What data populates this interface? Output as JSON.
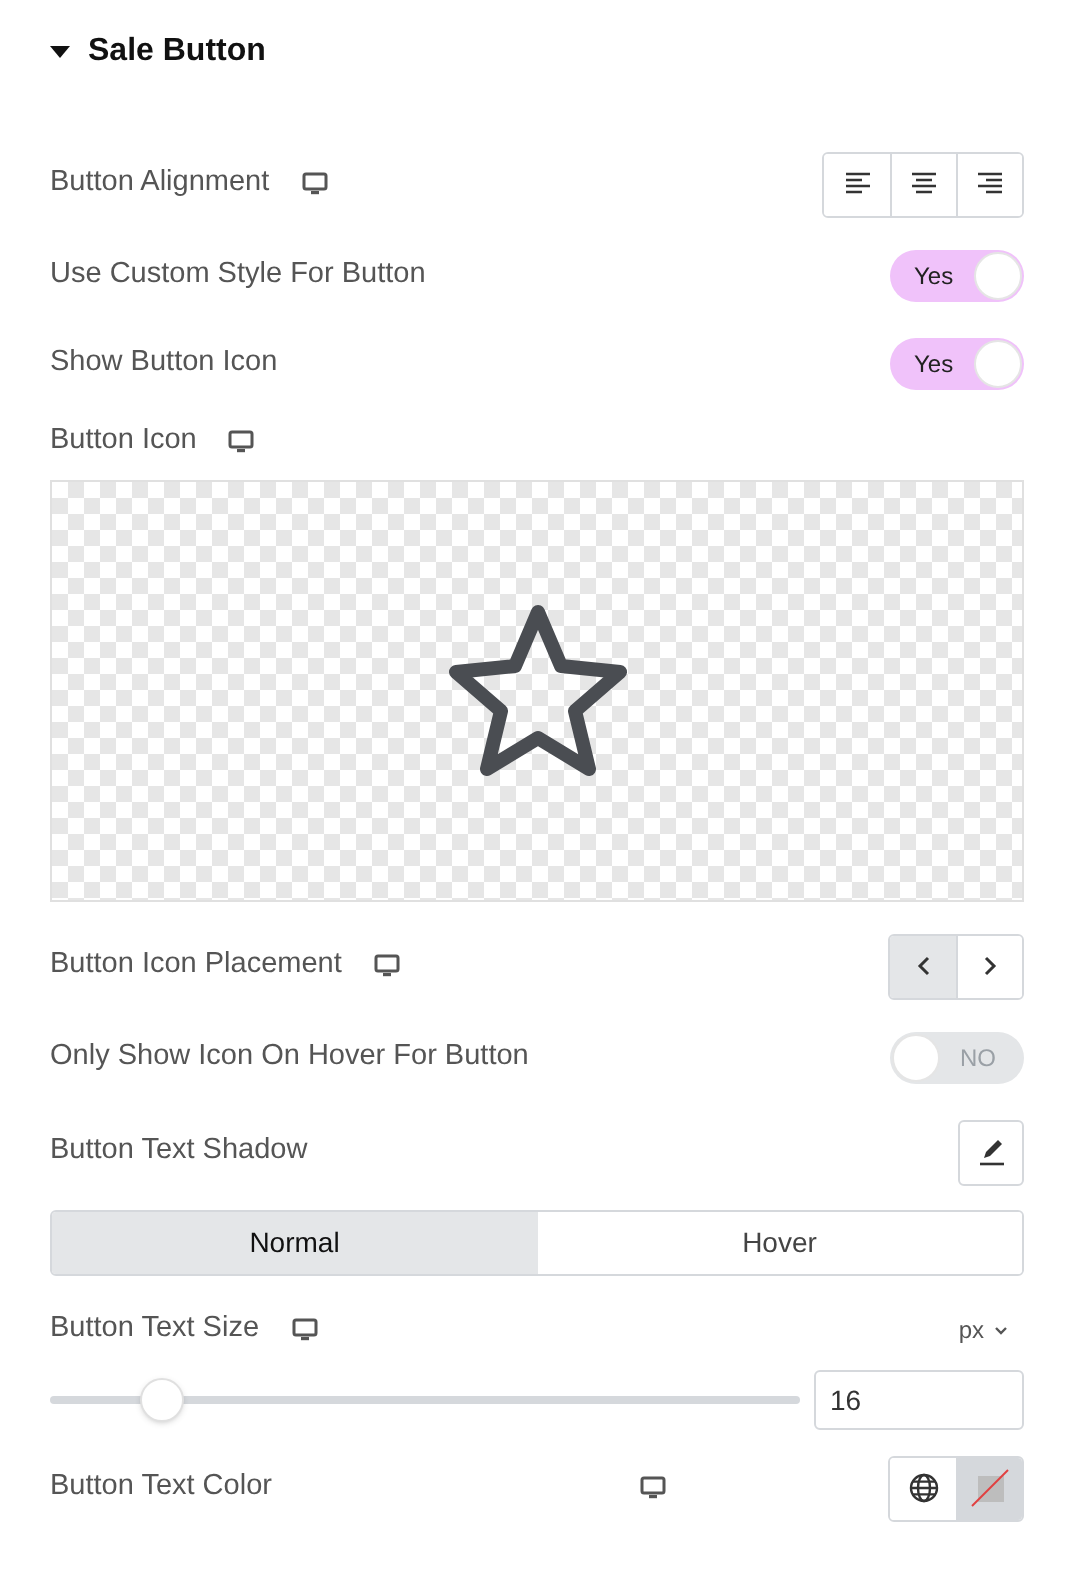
{
  "section": {
    "title": "Sale Button",
    "expanded": true
  },
  "controls": [
    {
      "kind": "choices",
      "label": "Button Alignment",
      "responsive": true,
      "options": [
        {
          "selected": false
        },
        {
          "selected": false
        },
        {
          "selected": false
        }
      ]
    },
    {
      "kind": "toggle",
      "label": "Use Custom Style For Button",
      "on": true,
      "text": "Yes"
    },
    {
      "kind": "toggle",
      "label": "Show Button Icon",
      "on": true,
      "text": "Yes"
    },
    {
      "kind": "icon",
      "label": "Button Icon",
      "responsive": true
    },
    {
      "kind": "choices",
      "label": "Button Icon Placement",
      "responsive": true,
      "options": [
        {
          "selected": true
        },
        {
          "selected": false
        }
      ]
    },
    {
      "kind": "toggle",
      "label": "Only Show Icon On Hover For Button",
      "on": false,
      "text": "NO"
    },
    {
      "kind": "edit",
      "label": "Button Text Shadow"
    },
    {
      "kind": "tabs",
      "tabs": [
        {
          "label": "Normal",
          "selected": true
        },
        {
          "label": "Hover",
          "selected": false
        }
      ]
    },
    {
      "kind": "slider",
      "label": "Button Text Size",
      "responsive": true,
      "unit": "px",
      "level": 0.15,
      "value": "16"
    },
    {
      "kind": "color",
      "label": "Button Text Color",
      "responsive": true
    }
  ]
}
